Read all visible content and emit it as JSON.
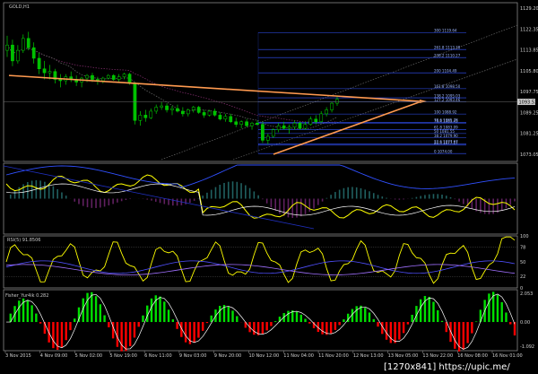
{
  "chart_data": [
    {
      "type": "line",
      "panel": "price",
      "title": "GOLD,H1",
      "y_ticks": [
        "1129.20",
        "1122.35",
        "1113.85",
        "1105.80",
        "1097.75",
        "1089.25",
        "1081.25",
        "1073.05"
      ],
      "current_price": "1093.53",
      "ylim": [
        1071,
        1131
      ],
      "candles": [
        [
          1113.0,
          1118.5,
          1110.5,
          1115.0
        ],
        [
          1115.0,
          1117.0,
          1107.0,
          1109.0
        ],
        [
          1109.0,
          1115.0,
          1108.0,
          1113.0
        ],
        [
          1113.0,
          1119.0,
          1112.0,
          1117.5
        ],
        [
          1117.5,
          1120.0,
          1113.0,
          1114.0
        ],
        [
          1114.0,
          1116.0,
          1108.0,
          1110.0
        ],
        [
          1110.0,
          1112.0,
          1104.0,
          1106.0
        ],
        [
          1106.0,
          1109.0,
          1102.0,
          1104.5
        ],
        [
          1104.5,
          1107.5,
          1102.0,
          1105.0
        ],
        [
          1105.0,
          1106.0,
          1100.5,
          1102.0
        ],
        [
          1102.0,
          1104.0,
          1099.0,
          1101.5
        ],
        [
          1101.5,
          1104.0,
          1100.0,
          1103.0
        ],
        [
          1103.0,
          1105.0,
          1101.0,
          1102.0
        ],
        [
          1102.0,
          1103.5,
          1099.5,
          1101.0
        ],
        [
          1101.0,
          1103.0,
          1099.0,
          1102.5
        ],
        [
          1102.5,
          1104.0,
          1101.0,
          1103.5
        ],
        [
          1103.5,
          1104.5,
          1101.0,
          1102.0
        ],
        [
          1102.0,
          1103.0,
          1100.0,
          1101.5
        ],
        [
          1101.5,
          1103.0,
          1100.5,
          1102.5
        ],
        [
          1102.5,
          1104.0,
          1102.0,
          1103.5
        ],
        [
          1103.5,
          1104.0,
          1101.5,
          1102.0
        ],
        [
          1102.0,
          1104.0,
          1101.0,
          1103.0
        ],
        [
          1103.0,
          1104.5,
          1102.0,
          1104.0
        ],
        [
          1104.0,
          1104.5,
          1100.0,
          1100.5
        ],
        [
          1100.5,
          1101.0,
          1085.0,
          1086.5
        ],
        [
          1086.5,
          1090.0,
          1084.5,
          1088.5
        ],
        [
          1088.5,
          1090.5,
          1086.0,
          1087.5
        ],
        [
          1087.5,
          1091.0,
          1087.0,
          1090.0
        ],
        [
          1090.0,
          1092.5,
          1089.0,
          1091.5
        ],
        [
          1091.5,
          1093.5,
          1090.5,
          1092.0
        ],
        [
          1092.0,
          1093.0,
          1089.5,
          1090.5
        ],
        [
          1090.5,
          1092.0,
          1088.5,
          1091.0
        ],
        [
          1091.0,
          1092.5,
          1089.5,
          1090.0
        ],
        [
          1090.0,
          1091.5,
          1088.0,
          1089.0
        ],
        [
          1089.0,
          1091.0,
          1088.0,
          1090.5
        ],
        [
          1090.5,
          1092.0,
          1089.5,
          1091.5
        ],
        [
          1091.5,
          1092.0,
          1089.0,
          1089.5
        ],
        [
          1089.5,
          1090.5,
          1087.5,
          1088.5
        ],
        [
          1088.5,
          1090.5,
          1088.0,
          1090.0
        ],
        [
          1090.0,
          1091.0,
          1088.0,
          1088.5
        ],
        [
          1088.5,
          1089.5,
          1086.5,
          1087.0
        ],
        [
          1087.0,
          1089.0,
          1086.0,
          1088.0
        ],
        [
          1088.0,
          1089.0,
          1085.5,
          1086.0
        ],
        [
          1086.0,
          1087.5,
          1084.0,
          1085.0
        ],
        [
          1085.0,
          1086.5,
          1083.5,
          1086.0
        ],
        [
          1086.0,
          1087.0,
          1084.0,
          1084.5
        ],
        [
          1084.5,
          1086.0,
          1083.0,
          1085.5
        ],
        [
          1085.5,
          1086.5,
          1084.5,
          1085.0
        ],
        [
          1085.0,
          1086.0,
          1078.0,
          1079.0
        ],
        [
          1079.0,
          1081.5,
          1077.5,
          1080.5
        ],
        [
          1080.5,
          1083.5,
          1080.0,
          1083.0
        ],
        [
          1083.0,
          1085.5,
          1082.0,
          1084.5
        ],
        [
          1084.5,
          1086.0,
          1083.0,
          1083.5
        ],
        [
          1083.5,
          1085.0,
          1081.5,
          1084.0
        ],
        [
          1084.0,
          1086.5,
          1083.0,
          1085.5
        ],
        [
          1085.5,
          1086.0,
          1083.0,
          1083.5
        ],
        [
          1083.5,
          1086.0,
          1083.0,
          1085.0
        ],
        [
          1085.0,
          1088.0,
          1084.5,
          1087.0
        ],
        [
          1087.0,
          1088.5,
          1085.0,
          1086.0
        ],
        [
          1086.0,
          1090.0,
          1085.5,
          1089.0
        ],
        [
          1089.0,
          1091.5,
          1088.0,
          1090.5
        ],
        [
          1090.5,
          1093.5,
          1089.5,
          1093.0
        ],
        [
          1093.0,
          1095.5,
          1092.0,
          1094.5
        ]
      ],
      "fib_levels": [
        "300 1119.64",
        "261.8 1113.30",
        "238.2 1110.27",
        "200 1104.49",
        "161.8 1098.50",
        "138.2 1095.03",
        "127.2 1093.46",
        "100 1088.92",
        "78.6 1085.78",
        "76.4 1085.45",
        "61.8 1083.09",
        "50 1081.55",
        "38.2 1079.90",
        "23.6 1077.67",
        "21.4 1077.17",
        "0 1074.00"
      ],
      "fib_values": [
        1119.64,
        1113.3,
        1110.27,
        1104.49,
        1098.5,
        1095.03,
        1093.46,
        1088.92,
        1085.78,
        1085.45,
        1083.09,
        1081.55,
        1079.9,
        1077.67,
        1077.17,
        1074.0
      ],
      "colors": {
        "bull": "#00c000",
        "bear": "#00c000",
        "trend": "#ff9a50",
        "fib": "#3355ff",
        "ma_purple": "#7a2a66",
        "ma_grey": "#606060"
      }
    },
    {
      "type": "line",
      "panel": "oscillator-1",
      "colors": {
        "yellow": "#ffff00",
        "white": "#ffffff",
        "blue": "#3050ff",
        "cyan": "#30a0a0",
        "magenta": "#a040a0"
      }
    },
    {
      "type": "line",
      "panel": "rsi",
      "title": "RSI(5) 91.8506",
      "y_ticks": [
        "100",
        "78",
        "50",
        "22",
        "0"
      ],
      "colors": {
        "yellow": "#ffff00",
        "blue": "#5050ff",
        "purple": "#a070ff"
      }
    },
    {
      "type": "bar",
      "panel": "fisher",
      "title": "Fisher_Yur4ik 0.282",
      "y_ticks": [
        "2.053",
        "0.00",
        "-1.092"
      ],
      "colors": {
        "pos": "#00e000",
        "neg": "#ff0000",
        "line": "#ffffff"
      }
    }
  ],
  "x_ticks": [
    "3 Nov 2015",
    "4 Nov 09:00",
    "5 Nov 02:00",
    "5 Nov 19:00",
    "6 Nov 11:00",
    "9 Nov 03:00",
    "9 Nov 20:00",
    "10 Nov 12:00",
    "11 Nov 04:00",
    "11 Nov 20:00",
    "12 Nov 13:00",
    "13 Nov 05:00",
    "13 Nov 22:00",
    "16 Nov 08:00",
    "16 Nov 01:00"
  ],
  "watermark": "[1270x841] https://upic.me/"
}
